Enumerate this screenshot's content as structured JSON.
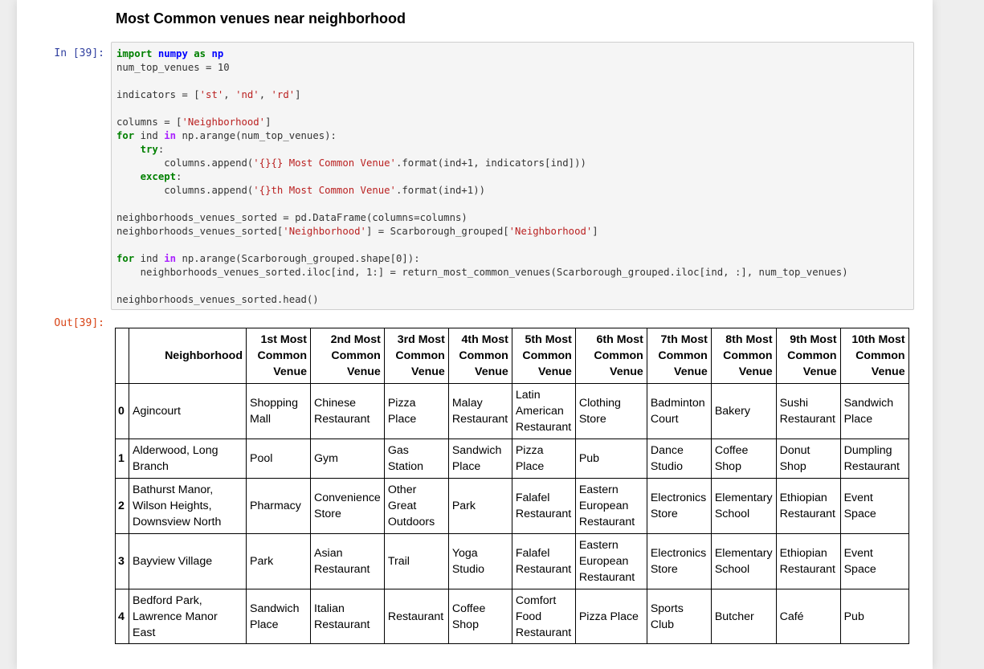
{
  "heading": "Most Common venues near neighborhood",
  "cell_in_prompt": "In [39]:",
  "cell_out_prompt": "Out[39]:",
  "code_lines": [
    "import numpy as np",
    "num_top_venues = 10",
    "",
    "indicators = ['st', 'nd', 'rd']",
    "",
    "columns = ['Neighborhood']",
    "for ind in np.arange(num_top_venues):",
    "    try:",
    "        columns.append('{}{} Most Common Venue'.format(ind+1, indicators[ind]))",
    "    except:",
    "        columns.append('{}th Most Common Venue'.format(ind+1))",
    "",
    "neighborhoods_venues_sorted = pd.DataFrame(columns=columns)",
    "neighborhoods_venues_sorted['Neighborhood'] = Scarborough_grouped['Neighborhood']",
    "",
    "for ind in np.arange(Scarborough_grouped.shape[0]):",
    "    neighborhoods_venues_sorted.iloc[ind, 1:] = return_most_common_venues(Scarborough_grouped.iloc[ind, :], num_top_venues)",
    "",
    "neighborhoods_venues_sorted.head()"
  ],
  "table": {
    "index_header": "",
    "headers": [
      "Neighborhood",
      "1st Most Common Venue",
      "2nd Most Common Venue",
      "3rd Most Common Venue",
      "4th Most Common Venue",
      "5th Most Common Venue",
      "6th Most Common Venue",
      "7th Most Common Venue",
      "8th Most Common Venue",
      "9th Most Common Venue",
      "10th Most Common Venue"
    ],
    "rows": [
      {
        "index": "0",
        "cells": [
          "Agincourt",
          "Shopping Mall",
          "Chinese Restaurant",
          "Pizza Place",
          "Malay Restaurant",
          "Latin American Restaurant",
          "Clothing Store",
          "Badminton Court",
          "Bakery",
          "Sushi Restaurant",
          "Sandwich Place"
        ]
      },
      {
        "index": "1",
        "cells": [
          "Alderwood, Long Branch",
          "Pool",
          "Gym",
          "Gas Station",
          "Sandwich Place",
          "Pizza Place",
          "Pub",
          "Dance Studio",
          "Coffee Shop",
          "Donut Shop",
          "Dumpling Restaurant"
        ]
      },
      {
        "index": "2",
        "cells": [
          "Bathurst Manor, Wilson Heights, Downsview North",
          "Pharmacy",
          "Convenience Store",
          "Other Great Outdoors",
          "Park",
          "Falafel Restaurant",
          "Eastern European Restaurant",
          "Electronics Store",
          "Elementary School",
          "Ethiopian Restaurant",
          "Event Space"
        ]
      },
      {
        "index": "3",
        "cells": [
          "Bayview Village",
          "Park",
          "Asian Restaurant",
          "Trail",
          "Yoga Studio",
          "Falafel Restaurant",
          "Eastern European Restaurant",
          "Electronics Store",
          "Elementary School",
          "Ethiopian Restaurant",
          "Event Space"
        ]
      },
      {
        "index": "4",
        "cells": [
          "Bedford Park, Lawrence Manor East",
          "Sandwich Place",
          "Italian Restaurant",
          "Restaurant",
          "Coffee Shop",
          "Comfort Food Restaurant",
          "Pizza Place",
          "Sports Club",
          "Butcher",
          "Café",
          "Pub"
        ]
      }
    ]
  }
}
